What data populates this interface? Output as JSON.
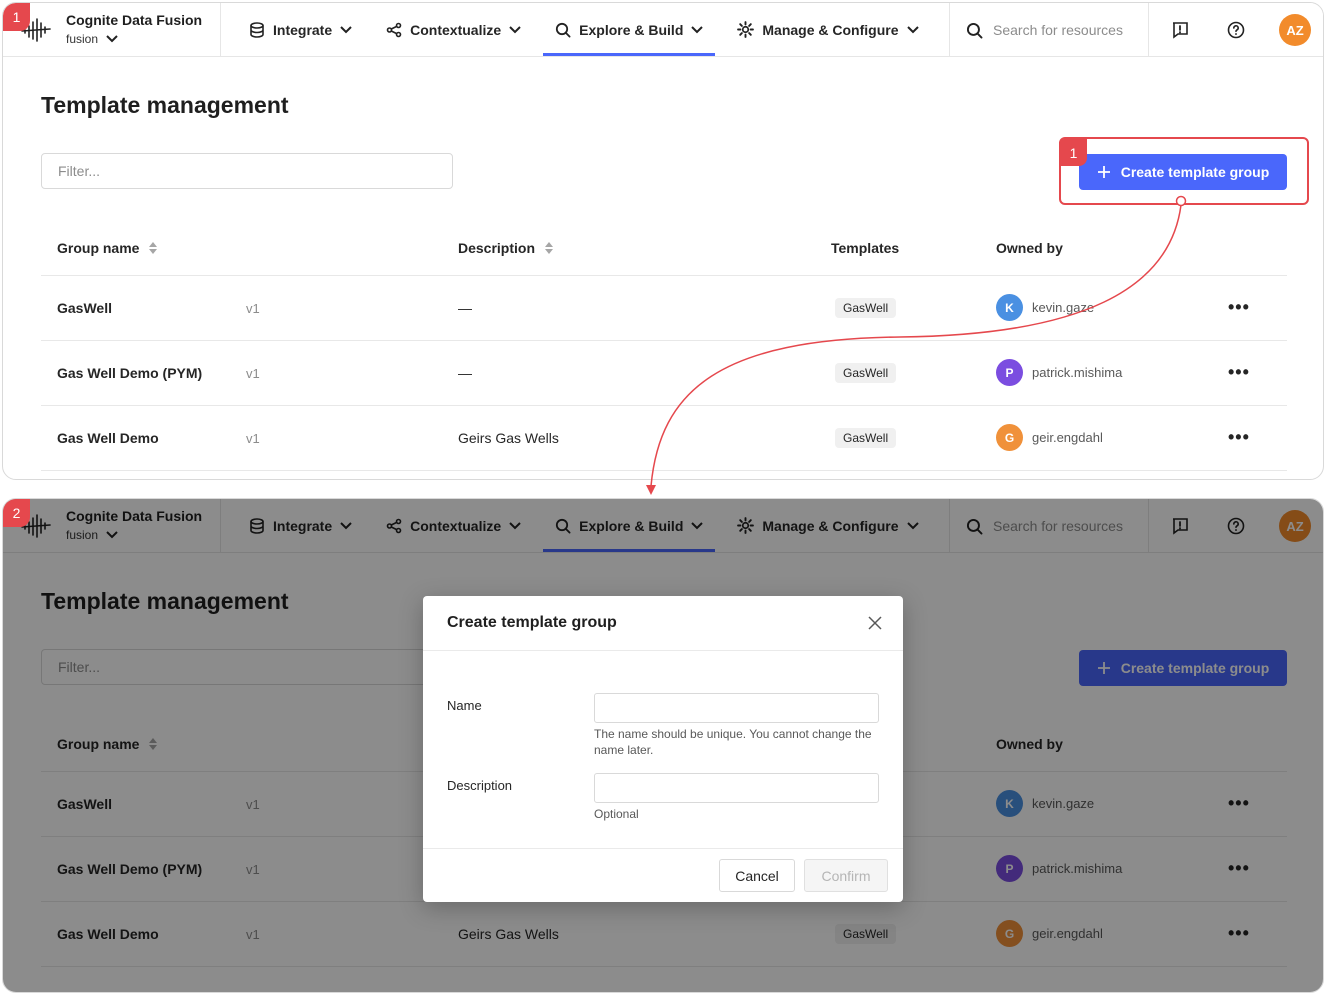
{
  "steps": {
    "first": "1",
    "second": "2"
  },
  "topbar": {
    "app_title": "Cognite Data Fusion",
    "project": "fusion",
    "nav": [
      {
        "label": "Integrate",
        "icon": "database-icon"
      },
      {
        "label": "Contextualize",
        "icon": "share-nodes-icon"
      },
      {
        "label": "Explore & Build",
        "icon": "search-icon",
        "active": true
      },
      {
        "label": "Manage & Configure",
        "icon": "gear-icon"
      }
    ],
    "search_placeholder": "Search for resources",
    "user_initials": "AZ"
  },
  "page": {
    "title": "Template management",
    "filter_placeholder": "Filter...",
    "create_button": "Create template group"
  },
  "table": {
    "headers": {
      "group_name": "Group name",
      "description": "Description",
      "templates": "Templates",
      "owned_by": "Owned by"
    },
    "rows": [
      {
        "name": "GasWell",
        "version": "v1",
        "description": "—",
        "template": "GasWell",
        "owner": "kevin.gaze",
        "owner_initial": "K"
      },
      {
        "name": "Gas Well Demo (PYM)",
        "version": "v1",
        "description": "—",
        "template": "GasWell",
        "owner": "patrick.mishima",
        "owner_initial": "P"
      },
      {
        "name": "Gas Well Demo",
        "version": "v1",
        "description": "Geirs Gas Wells",
        "template": "GasWell",
        "owner": "geir.engdahl",
        "owner_initial": "G"
      }
    ],
    "more_label": "•••"
  },
  "modal": {
    "title": "Create template group",
    "name_label": "Name",
    "name_help": "The name should be unique. You cannot change the name later.",
    "description_label": "Description",
    "description_help": "Optional",
    "cancel": "Cancel",
    "confirm": "Confirm"
  },
  "colors": {
    "accent": "#4a67fb",
    "highlight": "#e5484d",
    "avatar_user": "#f28b2b",
    "avatar_k": "#4a90e2",
    "avatar_p": "#7b4de0",
    "avatar_g": "#f0913a"
  }
}
